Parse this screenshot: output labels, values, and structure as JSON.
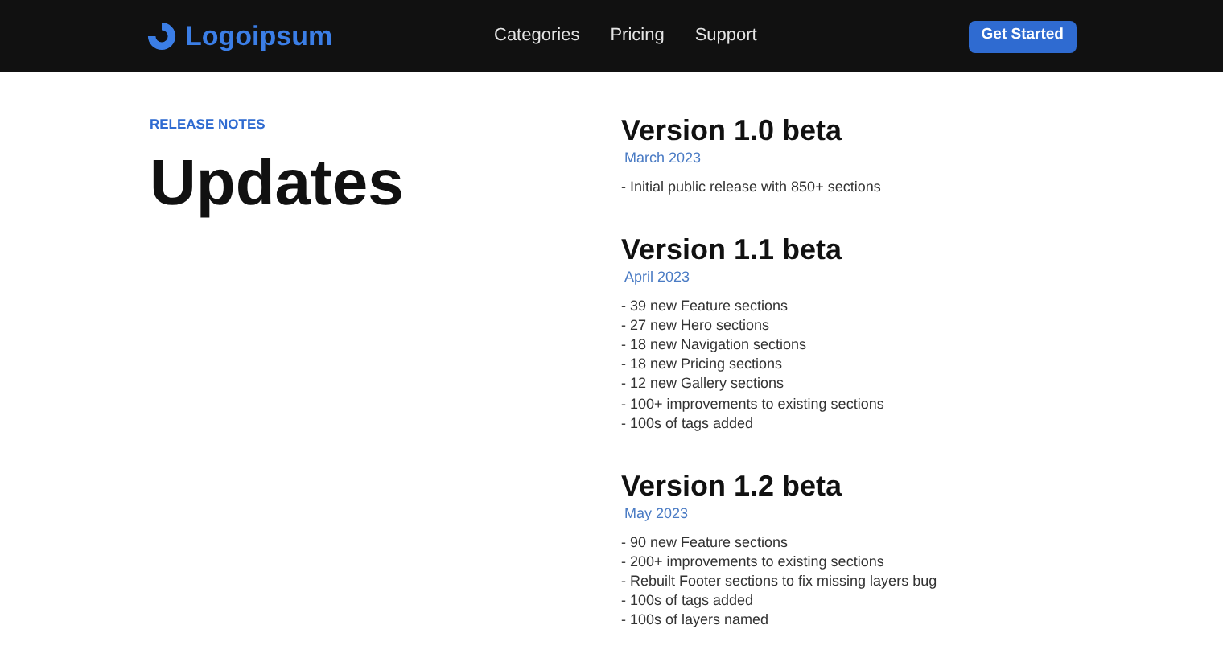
{
  "header": {
    "logo": "Logoipsum",
    "nav": [
      "Categories",
      "Pricing",
      "Support"
    ],
    "cta": "Get Started"
  },
  "intro": {
    "eyebrow": "RELEASE NOTES",
    "title": "Updates"
  },
  "releases": [
    {
      "version": "Version 1.0 beta",
      "date": "March 2023",
      "notes": [
        "- Initial public release with 850+ sections"
      ]
    },
    {
      "version": "Version 1.1 beta",
      "date": "April 2023",
      "notes": [
        "- 39 new Feature sections",
        "- 27 new Hero sections",
        "- 18 new Navigation sections",
        "- 18 new Pricing sections",
        "- 12 new Gallery sections",
        "- 100+ improvements to existing sections",
        "- 100s of tags added"
      ]
    },
    {
      "version": "Version 1.2 beta",
      "date": "May 2023",
      "notes": [
        "- 90 new Feature sections",
        "- 200+ improvements to existing sections",
        "- Rebuilt Footer sections to fix missing layers bug",
        "- 100s of tags added",
        "- 100s of layers named"
      ]
    }
  ]
}
